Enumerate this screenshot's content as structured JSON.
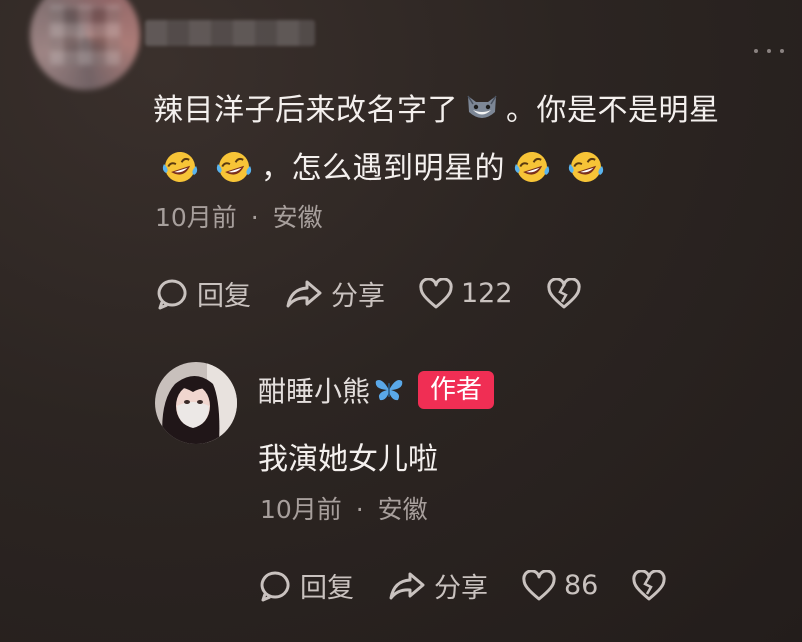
{
  "comment": {
    "text_part1": "辣目洋子后来改名字了",
    "text_part2": "。你是不是明星",
    "text_part3": "，怎么遇到明星的",
    "cat_emoji": "cat-emoji",
    "laugh_emoji": "rolling-laughing-emoji",
    "time": "10月前",
    "separator": "·",
    "location": "安徽",
    "reply_label": "回复",
    "share_label": "分享",
    "like_count": "122"
  },
  "reply": {
    "username": "酣睡小熊",
    "badge": "作者",
    "text": "我演她女儿啦",
    "time": "10月前",
    "separator": "·",
    "location": "安徽",
    "reply_label": "回复",
    "share_label": "分享",
    "like_count": "86"
  },
  "colors": {
    "background": "#2c2522",
    "author_badge": "#f02e54",
    "butterfly": "#5aa8e8",
    "meta_text": "#a79f9c"
  }
}
